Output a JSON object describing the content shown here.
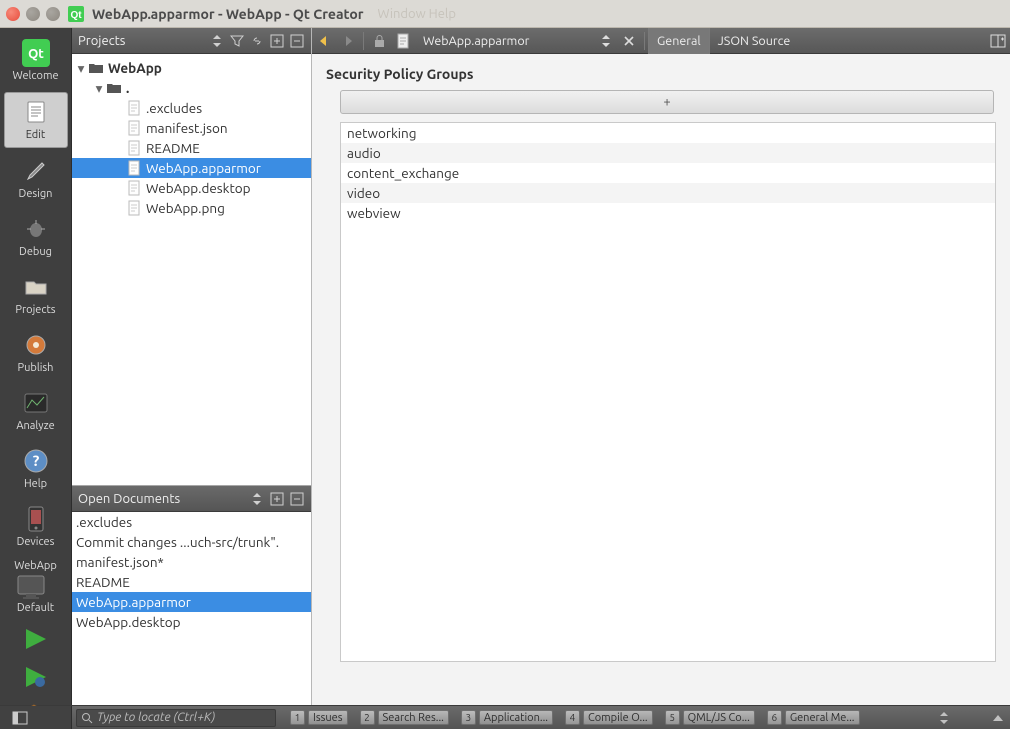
{
  "window": {
    "title": "WebApp.apparmor - WebApp - Qt Creator",
    "menus": "Window   Help"
  },
  "activity": {
    "items": [
      {
        "id": "welcome",
        "label": "Welcome"
      },
      {
        "id": "edit",
        "label": "Edit"
      },
      {
        "id": "design",
        "label": "Design"
      },
      {
        "id": "debug",
        "label": "Debug"
      },
      {
        "id": "projects",
        "label": "Projects"
      },
      {
        "id": "publish",
        "label": "Publish"
      },
      {
        "id": "analyze",
        "label": "Analyze"
      },
      {
        "id": "help",
        "label": "Help"
      },
      {
        "id": "devices",
        "label": "Devices"
      }
    ],
    "selected": "edit",
    "kit_project": "WebApp",
    "kit_config": "Default"
  },
  "projects_panel": {
    "title": "Projects",
    "root": "WebApp",
    "dot": ".",
    "files": [
      ".excludes",
      "manifest.json",
      "README",
      "WebApp.apparmor",
      "WebApp.desktop",
      "WebApp.png"
    ],
    "selected": "WebApp.apparmor"
  },
  "open_docs": {
    "title": "Open Documents",
    "items": [
      ".excludes",
      "Commit changes ...uch-src/trunk\".",
      "manifest.json*",
      "README",
      "WebApp.apparmor",
      "WebApp.desktop"
    ],
    "selected": "WebApp.apparmor"
  },
  "editor": {
    "file_combo": "WebApp.apparmor",
    "tabs": [
      "General",
      "JSON Source"
    ],
    "active_tab": "General",
    "heading": "Security Policy Groups",
    "add_symbol": "+",
    "policies": [
      "networking",
      "audio",
      "content_exchange",
      "video",
      "webview"
    ]
  },
  "status": {
    "locator_placeholder": "Type to locate (Ctrl+K)",
    "panes": [
      {
        "n": "1",
        "label": "Issues"
      },
      {
        "n": "2",
        "label": "Search Res..."
      },
      {
        "n": "3",
        "label": "Application..."
      },
      {
        "n": "4",
        "label": "Compile O..."
      },
      {
        "n": "5",
        "label": "QML/JS Co..."
      },
      {
        "n": "6",
        "label": "General Me..."
      }
    ]
  }
}
